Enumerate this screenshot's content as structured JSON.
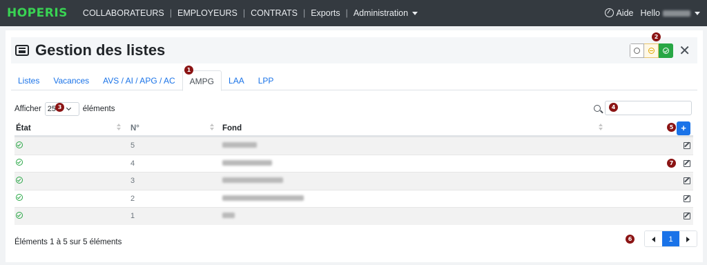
{
  "navbar": {
    "logo": "HOPERIS",
    "items": [
      "COLLABORATEURS",
      "EMPLOYEURS",
      "CONTRATS",
      "Exports",
      "Administration"
    ],
    "separator": "|",
    "help": "Aide",
    "hello": "Hello"
  },
  "header": {
    "title": "Gestion des listes",
    "close": "✕"
  },
  "tabs": [
    "Listes",
    "Vacances",
    "AVS / AI / APG / AC",
    "AMPG",
    "LAA",
    "LPP"
  ],
  "active_tab": "AMPG",
  "controls": {
    "show_label": "Afficher",
    "page_size": "25",
    "elements_label": "éléments",
    "search_value": ""
  },
  "table": {
    "headers": [
      "État",
      "N°",
      "Fond",
      ""
    ],
    "add_label": "+",
    "rows": [
      {
        "num": "5"
      },
      {
        "num": "4"
      },
      {
        "num": "3"
      },
      {
        "num": "2"
      },
      {
        "num": "1"
      }
    ]
  },
  "footer": {
    "summary": "Éléments 1 à 5 sur 5 éléments",
    "current_page": "1"
  },
  "callouts": [
    "1",
    "2",
    "3",
    "4",
    "5",
    "6",
    "7"
  ],
  "colors": {
    "navbar": "#343a40",
    "logo": "#39d353",
    "link": "#1a73e8",
    "success": "#28a745",
    "callout": "#8b1414"
  }
}
